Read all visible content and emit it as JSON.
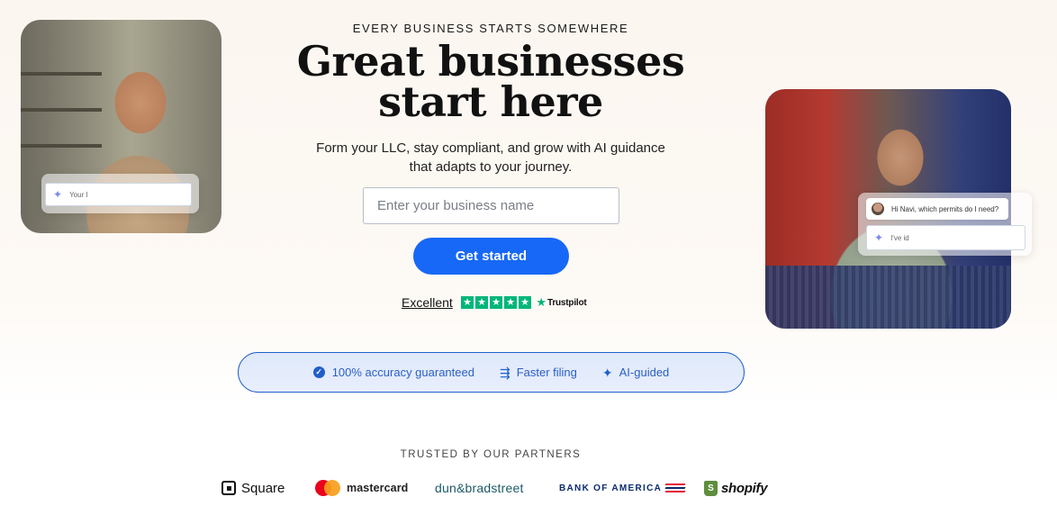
{
  "hero": {
    "eyebrow": "EVERY BUSINESS STARTS SOMEWHERE",
    "headline_line1": "Great businesses",
    "headline_line2": "start here",
    "subhead_line1": "Form your LLC, stay compliant, and grow with AI guidance",
    "subhead_line2": "that adapts to your journey.",
    "input_placeholder": "Enter your business name",
    "cta_label": "Get started"
  },
  "rating": {
    "label": "Excellent",
    "stars": 5,
    "provider": "Trustpilot"
  },
  "left_photo_card": {
    "input_text": "Your l"
  },
  "right_photo_card": {
    "bubble_text": "Hi Navi, which permits do I need?",
    "input_text": "I've id"
  },
  "features": [
    {
      "icon": "check-circle-icon",
      "label": "100% accuracy guaranteed"
    },
    {
      "icon": "fast-forward-icon",
      "label": "Faster filing"
    },
    {
      "icon": "sparkle-icon",
      "label": "AI-guided"
    }
  ],
  "partners": {
    "title": "TRUSTED BY OUR PARTNERS",
    "logos": [
      "Square",
      "mastercard",
      "dun&bradstreet",
      "BANK OF AMERICA",
      "shopify"
    ]
  },
  "colors": {
    "accent": "#1768f7",
    "trustpilot_green": "#00b67a",
    "feature_text": "#2b5fc6",
    "feature_border": "#1f5fc9"
  }
}
